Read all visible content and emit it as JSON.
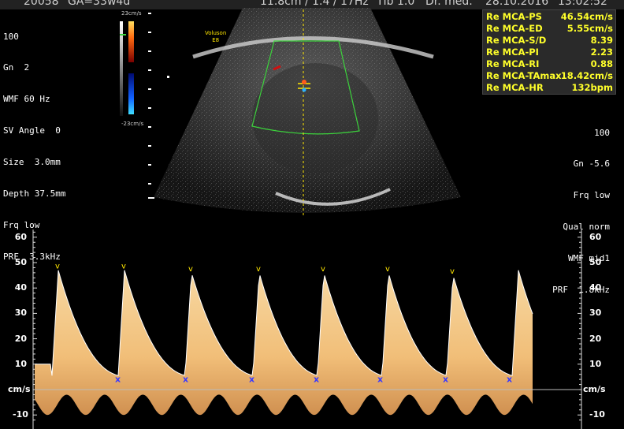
{
  "topbar": {
    "patient_id": "20058",
    "ga": "GA=33w4d",
    "probe_info": "11.8cm / 1.4 / 17Hz",
    "tib": "TIb 1.0",
    "doctor": "Dr. med.",
    "date": "28.10.2016",
    "time": "13:02:52"
  },
  "left_params": [
    "100",
    "Gn  2",
    "WMF 60 Hz",
    "SV Angle  0",
    "Size  3.0mm",
    "Depth 37.5mm",
    "Frq low",
    "PRF  3.3kHz"
  ],
  "right_params": [
    "100",
    "Gn -5.6",
    "Frq low",
    "Qual norm",
    "WMF mid1",
    "PRF  1.8kHz"
  ],
  "color_scale": {
    "top": "23cm/s",
    "bottom": "-23cm/s"
  },
  "probe_label": [
    "Voluson",
    "E8"
  ],
  "measurements": [
    {
      "label": "Re MCA-PS",
      "value": "46.54cm/s"
    },
    {
      "label": "Re MCA-ED",
      "value": "5.55cm/s"
    },
    {
      "label": "Re MCA-S/D",
      "value": "8.39"
    },
    {
      "label": "Re MCA-PI",
      "value": "2.23"
    },
    {
      "label": "Re MCA-RI",
      "value": "0.88"
    },
    {
      "label": "Re MCA-TAmax",
      "value": "18.42cm/s"
    },
    {
      "label": "Re MCA-HR",
      "value": "132bpm"
    }
  ],
  "doppler_axis": {
    "ticks": [
      "60",
      "50",
      "40",
      "30",
      "20",
      "10",
      "cm/s",
      "-10"
    ],
    "unit": "cm/s",
    "range": [
      -12,
      63
    ]
  },
  "colors": {
    "measure_text": "#ffff2a",
    "spectrum": "#f5c98a",
    "trace": "#ffffff",
    "sector": "#3cd23c"
  }
}
